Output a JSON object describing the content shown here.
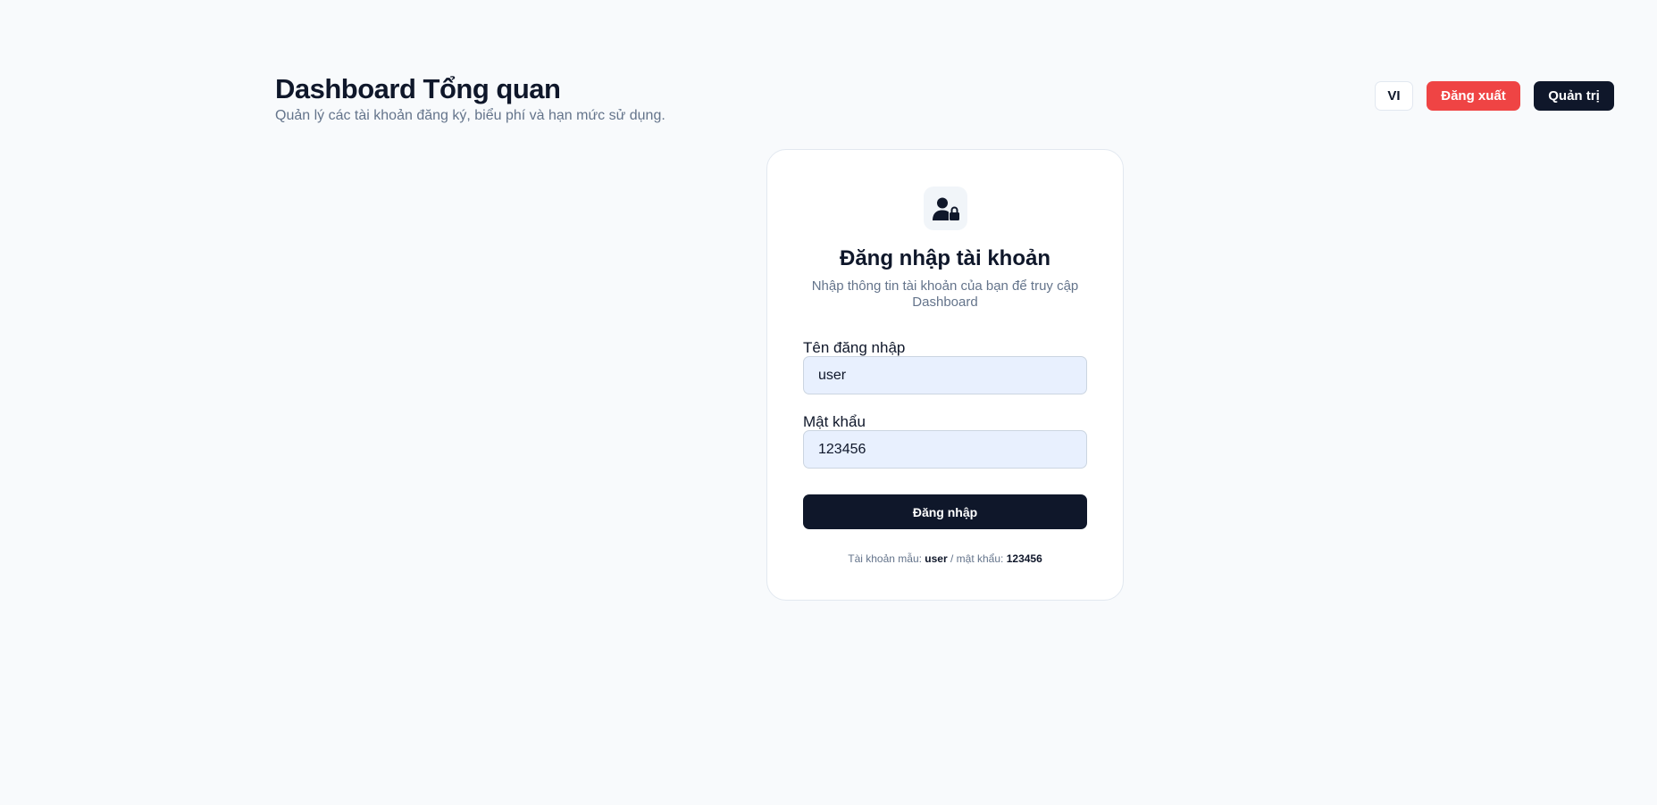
{
  "header": {
    "title": "Dashboard Tổng quan",
    "subtitle": "Quản lý các tài khoản đăng ký, biểu phí và hạn mức sử dụng."
  },
  "actions": {
    "language_label": "VI",
    "logout_label": "Đăng xuất",
    "admin_label": "Quản trị"
  },
  "login": {
    "icon": "user-lock-icon",
    "title": "Đăng nhập tài khoản",
    "subtitle": "Nhập thông tin tài khoản của bạn để truy cập Dashboard",
    "username_label": "Tên đăng nhập",
    "username_value": "user",
    "password_label": "Mật khẩu",
    "password_value": "123456",
    "submit_label": "Đăng nhập",
    "hint_prefix": "Tài khoản mẫu:",
    "hint_user": "user",
    "hint_separator": "/ mật khẩu:",
    "hint_password": "123456"
  },
  "colors": {
    "background": "#f8fafc",
    "primary": "#0f172a",
    "danger": "#ef4444",
    "input_autofill": "#e8f0fe"
  }
}
